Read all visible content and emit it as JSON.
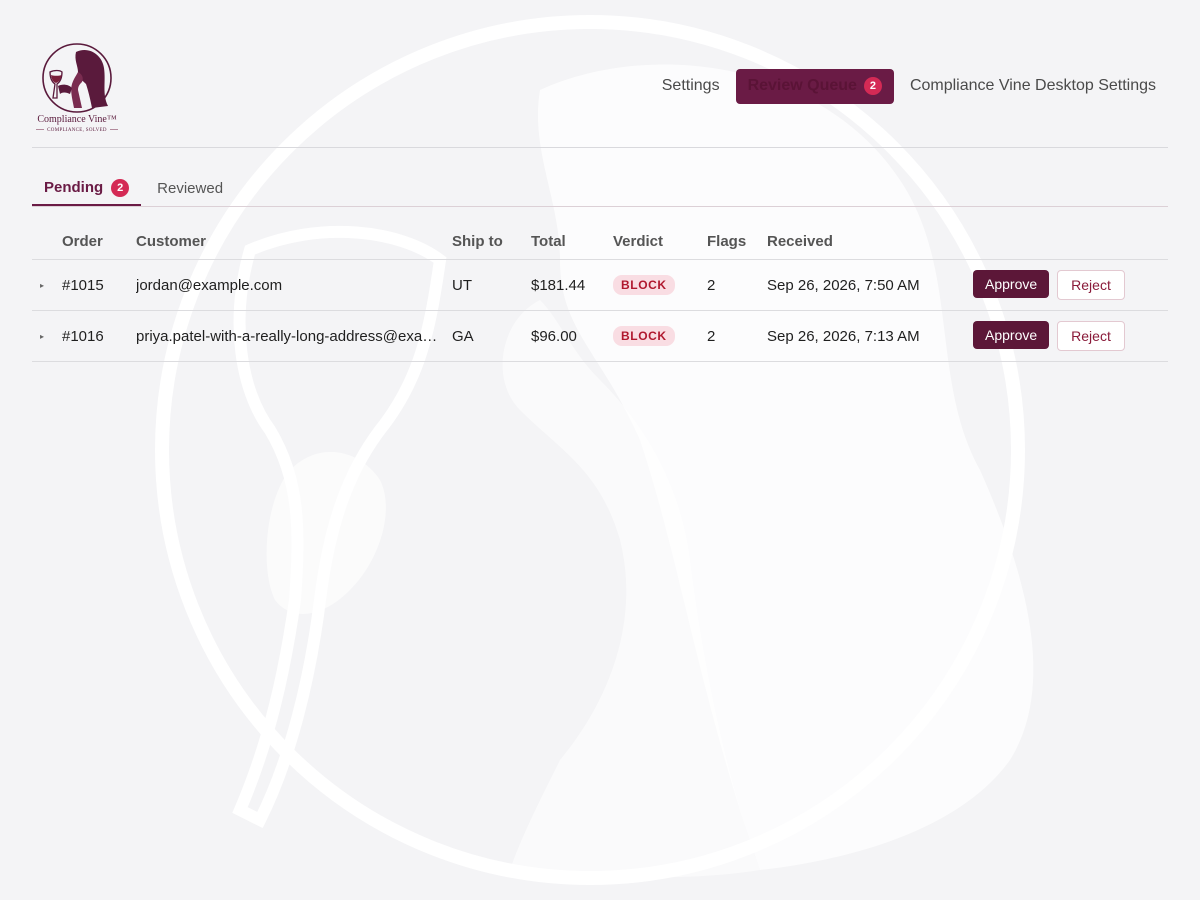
{
  "brand": {
    "name": "Compliance Vine™",
    "tagline": "COMPLIANCE, SOLVED",
    "primary_color": "#5c1738",
    "badge_color": "#d42a55"
  },
  "nav": {
    "settings": "Settings",
    "review_queue": "Review Queue",
    "review_queue_count": "2",
    "desktop_settings": "Compliance Vine Desktop Settings"
  },
  "tabs": {
    "pending": "Pending",
    "pending_count": "2",
    "reviewed": "Reviewed"
  },
  "table": {
    "headers": {
      "order": "Order",
      "customer": "Customer",
      "ship_to": "Ship to",
      "total": "Total",
      "verdict": "Verdict",
      "flags": "Flags",
      "received": "Received"
    },
    "rows": [
      {
        "expand": "▸",
        "order": "#1015",
        "customer": "jordan@example.com",
        "ship_to": "UT",
        "total": "$181.44",
        "verdict": "BLOCK",
        "flags": "2",
        "received": "Sep 26, 2026, 7:50 AM",
        "approve": "Approve",
        "reject": "Reject"
      },
      {
        "expand": "▸",
        "order": "#1016",
        "customer": "priya.patel-with-a-really-long-address@example.com",
        "ship_to": "GA",
        "total": "$96.00",
        "verdict": "BLOCK",
        "flags": "2",
        "received": "Sep 26, 2026, 7:13 AM",
        "approve": "Approve",
        "reject": "Reject"
      }
    ]
  }
}
